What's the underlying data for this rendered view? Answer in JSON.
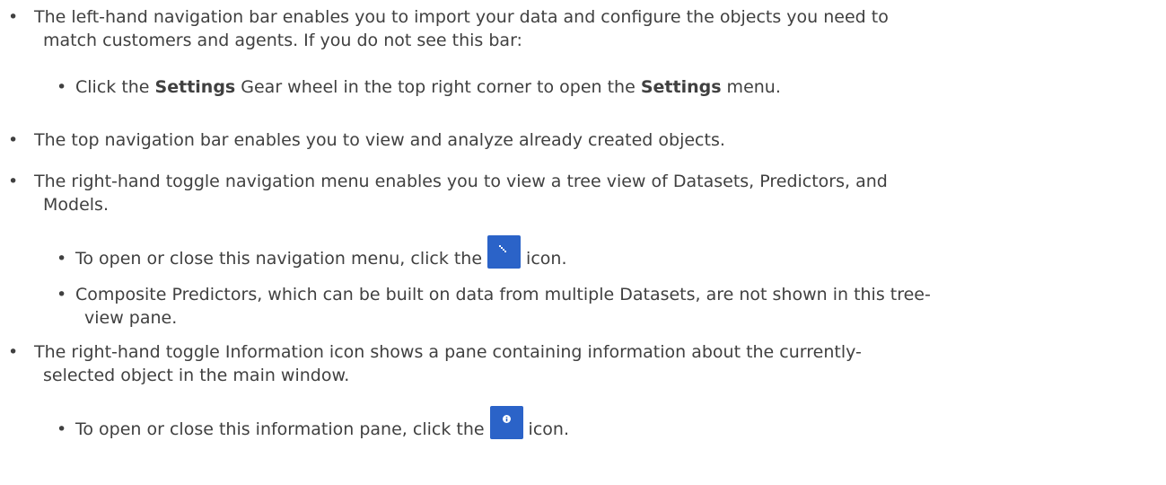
{
  "items": [
    {
      "lines": [
        "The left-hand navigation bar enables you to import your data and configure the objects you need to",
        "match customers and agents. If you do not see this bar:"
      ]
    },
    {
      "pre": "Click the ",
      "bold1": "Settings",
      "mid": " Gear wheel in the top right corner to open the ",
      "bold2": "Settings",
      "post": " menu."
    },
    {
      "lines": [
        "The top navigation bar enables you to view and analyze already created objects."
      ]
    },
    {
      "lines": [
        "The right-hand toggle navigation menu enables you to view a tree view of Datasets, Predictors, and",
        "Models."
      ]
    },
    {
      "pre": "To open or close this navigation menu, click the",
      "post": "icon.",
      "icon": "tree-toggle-icon"
    },
    {
      "lines": [
        "Composite Predictors, which can be built on data from multiple Datasets, are not shown in this tree-",
        "view pane."
      ]
    },
    {
      "lines": [
        "The right-hand toggle Information icon shows a pane containing information about the currently-",
        "selected object in the main window."
      ]
    },
    {
      "pre": "To open or close this information pane, click the",
      "post": "icon.",
      "icon": "info-icon"
    }
  ],
  "colors": {
    "text": "#404040",
    "icon_bg": "#2b63c8"
  }
}
